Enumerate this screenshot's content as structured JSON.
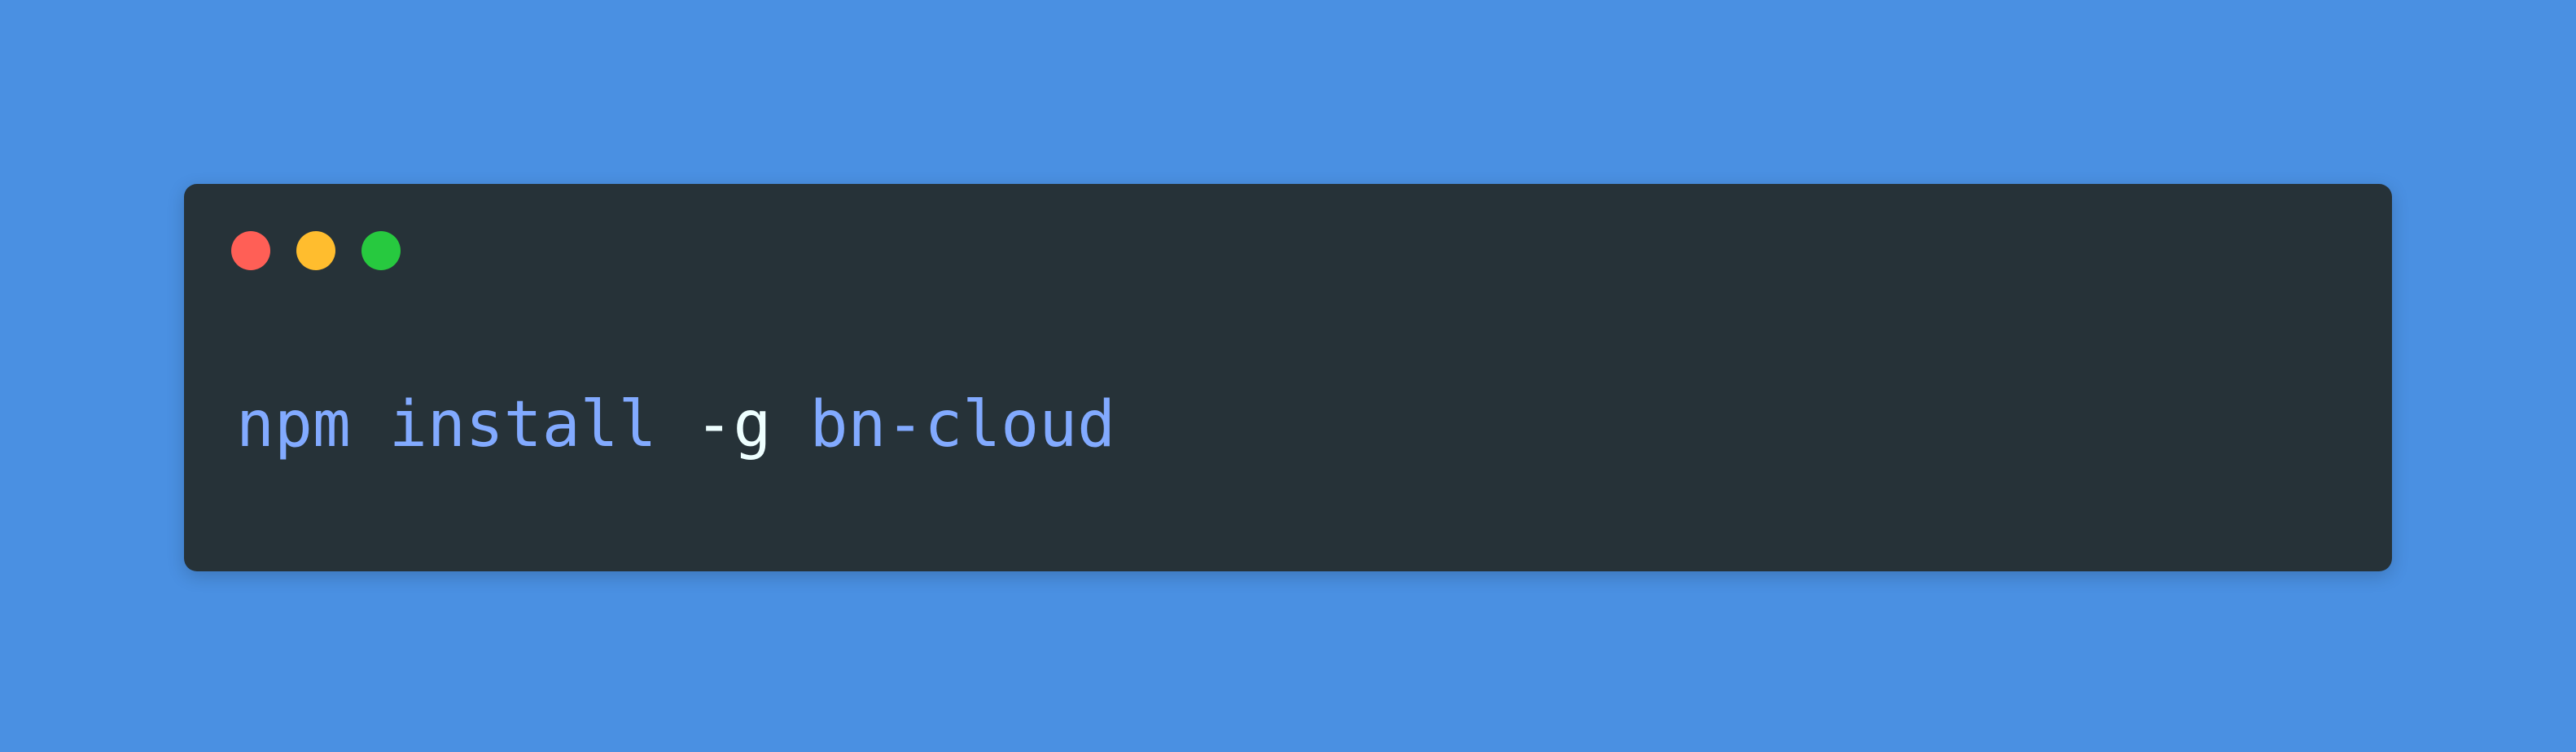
{
  "colors": {
    "background": "#4a90e2",
    "window": "#263238",
    "close": "#ff5f56",
    "minimize": "#ffbd2e",
    "maximize": "#27c93f",
    "command_text": "#82aaff",
    "flag_text": "#eeffff"
  },
  "window_controls": [
    "close",
    "minimize",
    "maximize"
  ],
  "code": {
    "cmd": "npm",
    "sub": "install",
    "flag": "-g",
    "pkg": "bn-cloud"
  }
}
